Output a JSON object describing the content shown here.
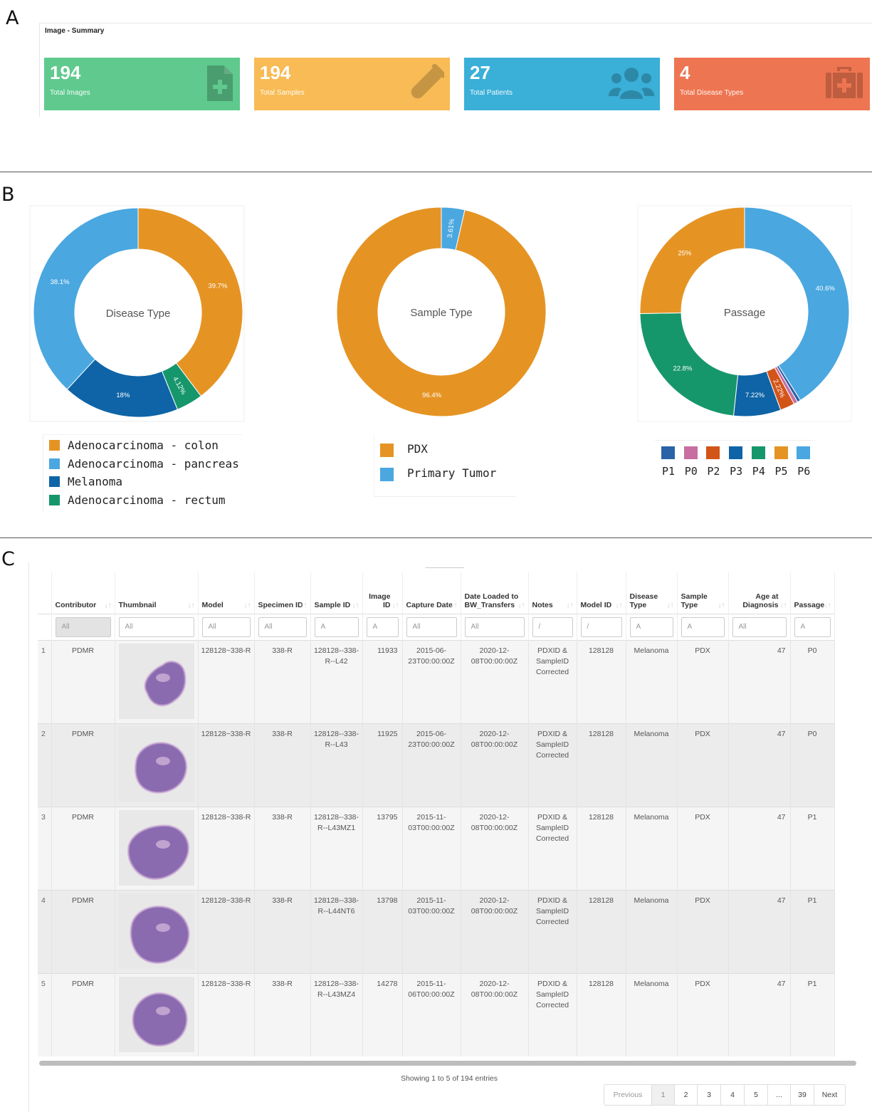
{
  "panels": {
    "a": "A",
    "b": "B",
    "c": "C"
  },
  "summary": {
    "title": "Image - Summary",
    "cards": [
      {
        "value": "194",
        "label": "Total Images",
        "color": "#5fc98e",
        "icon": "file-plus-icon"
      },
      {
        "value": "194",
        "label": "Total Samples",
        "color": "#f8bb55",
        "icon": "test-tube-icon"
      },
      {
        "value": "27",
        "label": "Total Patients",
        "color": "#3aafd7",
        "icon": "users-icon"
      },
      {
        "value": "4",
        "label": "Total Disease Types",
        "color": "#ee7551",
        "icon": "medkit-icon"
      }
    ]
  },
  "chart_data": [
    {
      "type": "pie",
      "title": "Disease Type",
      "categories": [
        "Adenocarcinoma - colon",
        "Adenocarcinoma - rectum",
        "Melanoma",
        "Adenocarcinoma - pancreas"
      ],
      "values": [
        39.7,
        4.12,
        18,
        38.1
      ],
      "labels": [
        "39.7%",
        "4.12%",
        "18%",
        "38.1%"
      ],
      "colors": [
        "#e59424",
        "#16966b",
        "#0e64a6",
        "#4aa7e0"
      ],
      "legend_order": [
        0,
        3,
        2,
        1
      ],
      "legend_placement": "bottom"
    },
    {
      "type": "pie",
      "title": "Sample Type",
      "categories": [
        "Primary Tumor",
        "PDX"
      ],
      "values": [
        3.61,
        96.4
      ],
      "labels": [
        "3.61%",
        "96.4%"
      ],
      "colors": [
        "#4aa7e0",
        "#e59424"
      ],
      "legend_order": [
        1,
        0
      ],
      "legend_placement": "bottom"
    },
    {
      "type": "pie",
      "title": "Passage",
      "categories": [
        "P6",
        "P1",
        "P0",
        "P2",
        "P3",
        "P4",
        "P5"
      ],
      "values": [
        40.6,
        0.5,
        0.6,
        2.22,
        7.22,
        22.8,
        25
      ],
      "labels": [
        "40.6%",
        "",
        "",
        "2.22%",
        "7.22%",
        "22.8%",
        "25%"
      ],
      "colors": [
        "#4aa7e0",
        "#2a63a6",
        "#c86ea1",
        "#d35418",
        "#0e64a6",
        "#16966b",
        "#e59424"
      ],
      "legend": [
        {
          "label": "P1",
          "color": "#2a63a6"
        },
        {
          "label": "P0",
          "color": "#c86ea1"
        },
        {
          "label": "P2",
          "color": "#d35418"
        },
        {
          "label": "P3",
          "color": "#0e64a6"
        },
        {
          "label": "P4",
          "color": "#16966b"
        },
        {
          "label": "P5",
          "color": "#e59424"
        },
        {
          "label": "P6",
          "color": "#4aa7e0"
        }
      ],
      "legend_placement": "bottom"
    }
  ],
  "table": {
    "columns": [
      {
        "label": "",
        "filter": ""
      },
      {
        "label": "Contributor",
        "filter": "All"
      },
      {
        "label": "Thumbnail",
        "filter": "All"
      },
      {
        "label": "Model",
        "filter": "All"
      },
      {
        "label": "Specimen ID",
        "filter": "All"
      },
      {
        "label": "Sample ID",
        "filter": "A"
      },
      {
        "label": "Image ID",
        "filter": "A"
      },
      {
        "label": "Capture Date",
        "filter": "All"
      },
      {
        "label": "Date Loaded to BW_Transfers",
        "filter": "All"
      },
      {
        "label": "Notes",
        "filter": "/"
      },
      {
        "label": "Model ID",
        "filter": "/"
      },
      {
        "label": "Disease Type",
        "filter": "A"
      },
      {
        "label": "Sample Type",
        "filter": "A"
      },
      {
        "label": "Age at Diagnosis",
        "filter": "All"
      },
      {
        "label": "Passage",
        "filter": "A"
      }
    ],
    "rows": [
      {
        "n": "1",
        "contributor": "PDMR",
        "model": "128128~338-R",
        "specimen": "338-R",
        "sample": "128128--338-R--L42",
        "image": "11933",
        "capture": "2015-06-23T00:00:00Z",
        "loaded": "2020-12-08T00:00:00Z",
        "notes": "PDXID & SampleID Corrected",
        "model_id": "128128",
        "disease": "Melanoma",
        "sample_type": "PDX",
        "age": "47",
        "passage": "P0"
      },
      {
        "n": "2",
        "contributor": "PDMR",
        "model": "128128~338-R",
        "specimen": "338-R",
        "sample": "128128--338-R--L43",
        "image": "11925",
        "capture": "2015-06-23T00:00:00Z",
        "loaded": "2020-12-08T00:00:00Z",
        "notes": "PDXID & SampleID Corrected",
        "model_id": "128128",
        "disease": "Melanoma",
        "sample_type": "PDX",
        "age": "47",
        "passage": "P0"
      },
      {
        "n": "3",
        "contributor": "PDMR",
        "model": "128128~338-R",
        "specimen": "338-R",
        "sample": "128128--338-R--L43MZ1",
        "image": "13795",
        "capture": "2015-11-03T00:00:00Z",
        "loaded": "2020-12-08T00:00:00Z",
        "notes": "PDXID & SampleID Corrected",
        "model_id": "128128",
        "disease": "Melanoma",
        "sample_type": "PDX",
        "age": "47",
        "passage": "P1"
      },
      {
        "n": "4",
        "contributor": "PDMR",
        "model": "128128~338-R",
        "specimen": "338-R",
        "sample": "128128--338-R--L44NT6",
        "image": "13798",
        "capture": "2015-11-03T00:00:00Z",
        "loaded": "2020-12-08T00:00:00Z",
        "notes": "PDXID & SampleID Corrected",
        "model_id": "128128",
        "disease": "Melanoma",
        "sample_type": "PDX",
        "age": "47",
        "passage": "P1"
      },
      {
        "n": "5",
        "contributor": "PDMR",
        "model": "128128~338-R",
        "specimen": "338-R",
        "sample": "128128--338-R--L43MZ4",
        "image": "14278",
        "capture": "2015-11-06T00:00:00Z",
        "loaded": "2020-12-08T00:00:00Z",
        "notes": "PDXID & SampleID Corrected",
        "model_id": "128128",
        "disease": "Melanoma",
        "sample_type": "PDX",
        "age": "47",
        "passage": "P1"
      }
    ],
    "info": "Showing 1 to 5 of 194 entries",
    "pagination": [
      "Previous",
      "1",
      "2",
      "3",
      "4",
      "5",
      "...",
      "39",
      "Next"
    ]
  }
}
